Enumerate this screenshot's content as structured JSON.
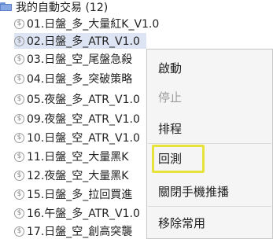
{
  "tree": {
    "folder_label": "我的自動交易 (12)",
    "items": [
      {
        "label": "01.日盤_多_大量紅K_V1.0",
        "selected": false
      },
      {
        "label": "02.日盤_多_ATR_V1.0",
        "selected": true
      },
      {
        "label": "03.日盤_空_尾盤急殺",
        "selected": false
      },
      {
        "label": "04.日盤_多_突破策略",
        "selected": false
      },
      {
        "label": "05.夜盤_多_ATR_V1.0",
        "selected": false
      },
      {
        "label": "09.夜盤_空_ATR_V1.0",
        "selected": false
      },
      {
        "label": "10.日盤_空_ATR_V1.0",
        "selected": false
      },
      {
        "label": "11.日盤_空_大量黑K",
        "selected": false
      },
      {
        "label": "12.夜盤_空_大量黑K",
        "selected": false
      },
      {
        "label": "15.日盤_多_拉回買進",
        "selected": false
      },
      {
        "label": "16.午盤_多_ATR_V1.0",
        "selected": false
      },
      {
        "label": "17.日盤_空_創高突襲",
        "selected": false
      }
    ]
  },
  "context_menu": {
    "items": [
      {
        "label": "啟動",
        "enabled": true
      },
      {
        "label": "停止",
        "enabled": false
      },
      {
        "label": "排程",
        "enabled": true
      },
      {
        "label": "回測",
        "enabled": true,
        "highlighted": true
      },
      {
        "label": "關閉手機推播",
        "enabled": true
      },
      {
        "label": "移除常用",
        "enabled": true
      }
    ]
  },
  "colors": {
    "selection": "#dde4f3",
    "highlight_border": "#e7e33a",
    "menu_background": "#f5f5f5",
    "disabled_text": "#9b9b9b"
  },
  "icons": {
    "folder": "folder-icon",
    "strategy": "dollar-circle-icon"
  }
}
